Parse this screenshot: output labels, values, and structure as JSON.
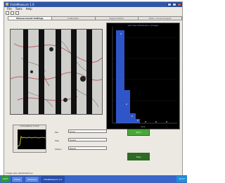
{
  "window": {
    "title": "VistaMeasure 1.0"
  },
  "menu": [
    "File",
    "Tools",
    "Help"
  ],
  "tabs": [
    {
      "label": "Measurement Settings",
      "active": true
    },
    {
      "label": "Calibration",
      "active": false
    },
    {
      "label": "Segmentation",
      "active": false
    },
    {
      "label": "Data / visual analysis",
      "active": false
    }
  ],
  "plot": {
    "title": "Cell Size Distribution (Image)",
    "xlabel": "Size",
    "colors": {
      "bar": "#2f55c8",
      "background": "#000000"
    }
  },
  "waveform": {
    "title": "Cumulative Curve"
  },
  "fields": [
    {
      "label": "Min",
      "value": "[min]"
    },
    {
      "label": "Max",
      "value": "[max]"
    },
    {
      "label": "Status",
      "value": "Ready"
    }
  ],
  "buttons": {
    "start": "Start",
    "stop": "Stop"
  },
  "status": {
    "text": "Image size 1024x1024 px"
  },
  "taskbar": {
    "start": "start",
    "tasks": [
      "Folder",
      "Measure",
      "VistaMeasure 1.0"
    ],
    "clock": "10:47"
  }
}
